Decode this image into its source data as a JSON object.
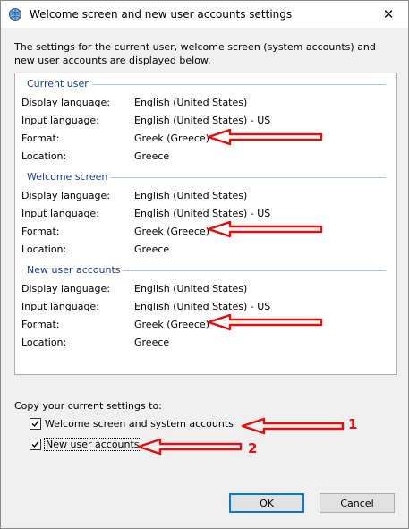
{
  "window": {
    "title": "Welcome screen and new user accounts settings",
    "close_label": "✕"
  },
  "intro": "The settings for the current user, welcome screen (system accounts) and new user accounts are displayed below.",
  "labels": {
    "display_language": "Display language:",
    "input_language": "Input language:",
    "format": "Format:",
    "location": "Location:"
  },
  "sections": {
    "current_user": {
      "title": "Current user",
      "display_language": "English (United States)",
      "input_language": "English (United States) - US",
      "format": "Greek (Greece)",
      "location": "Greece"
    },
    "welcome_screen": {
      "title": "Welcome screen",
      "display_language": "English (United States)",
      "input_language": "English (United States) - US",
      "format": "Greek (Greece)",
      "location": "Greece"
    },
    "new_user_accounts": {
      "title": "New user accounts",
      "display_language": "English (United States)",
      "input_language": "English (United States) - US",
      "format": "Greek (Greece)",
      "location": "Greece"
    }
  },
  "copy": {
    "label": "Copy your current settings to:",
    "welcome_checkbox": "Welcome screen and system accounts",
    "welcome_checked": true,
    "new_user_checkbox": "New user accounts",
    "new_user_checked": true
  },
  "buttons": {
    "ok": "OK",
    "cancel": "Cancel"
  },
  "annotations": {
    "marker_1": "1",
    "marker_2": "2",
    "arrow_color": "#e01010"
  }
}
